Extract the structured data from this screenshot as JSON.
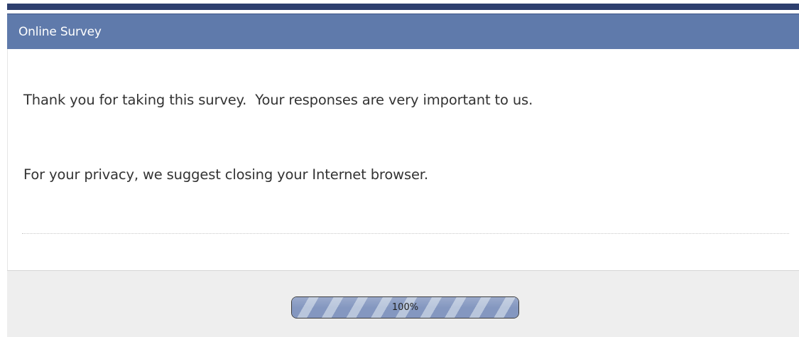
{
  "header": {
    "title": "Online Survey"
  },
  "main": {
    "message_1": "Thank you for taking this survey.  Your responses are very important to us.",
    "message_2": "For your privacy, we suggest closing your Internet browser."
  },
  "footer": {
    "progress": {
      "label": "100%",
      "percent": 100
    }
  },
  "colors": {
    "header_bar": "#5f7aab",
    "top_strip": "#2d3f6e",
    "footer_bg": "#eeeeee",
    "progress_fill": "#8b9fc6",
    "text": "#333333"
  }
}
